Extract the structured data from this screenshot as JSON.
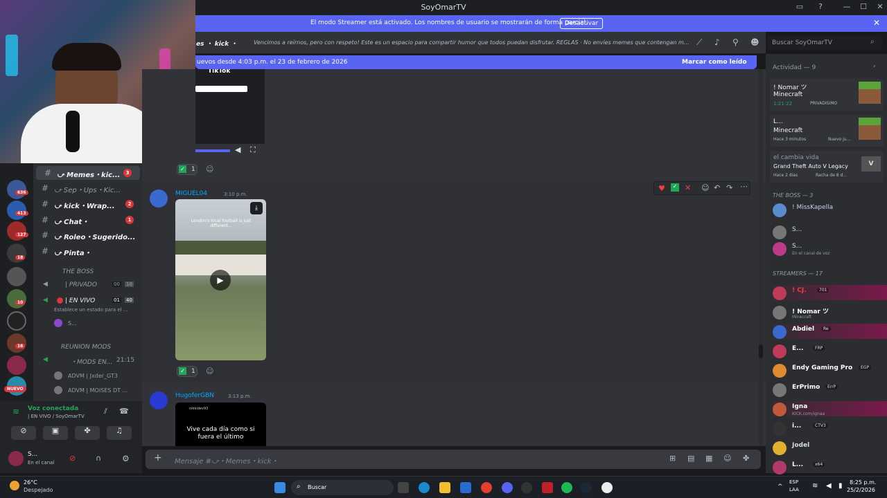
{
  "window": {
    "title": "SoyOmarTV"
  },
  "streamer_banner": {
    "message": "El modo Streamer está activado. Los nombres de usuario se mostrarán de forma parcial.",
    "button": "Desactivar"
  },
  "channel_header": {
    "name": "es ・ kick ・",
    "topic": "Vencimos a reírnos, pero con respeto! Este es un espacio para compartir humor que todos puedan disfrutar. REGLAS · No envíes memes que contengan m...",
    "search_placeholder": "Buscar SoyOmarTV"
  },
  "new_messages_bar": {
    "text": "uevos desde 4:03 p.m. el 23 de febrero de 2026",
    "action": "Marcar como leído"
  },
  "server_badges": [
    "636",
    "413",
    "127",
    "18",
    "10",
    "16"
  ],
  "channels": [
    {
      "name": "⤻ Memes・kic...",
      "badge": "3"
    },
    {
      "name": "⤻ Sep・Ups・Kic...",
      "badge": ""
    },
    {
      "name": "⤻ kick・Wrap...",
      "badge": "2"
    },
    {
      "name": "⤻ Chat・",
      "badge": "1"
    },
    {
      "name": "⤻ Roleo・Sugerido...",
      "badge": ""
    },
    {
      "name": "⤻ Pinta・",
      "badge": ""
    }
  ],
  "category_boss": "THE BOSS",
  "voice_channels": [
    {
      "name": "| PRIVADO",
      "count_a": "00",
      "count_b": "10"
    },
    {
      "name": "| EN VIVO",
      "count_a": "01",
      "count_b": "40"
    }
  ],
  "vc_status": "Establece un estado para el ...",
  "vc_user": "S...",
  "category_mods": "REUNION MODS",
  "mods_channel": {
    "name": "・MODS EN...",
    "time": "21:15"
  },
  "mods_users": [
    "ADVM | Jxder_GT3",
    "ADVM | MOISES DT ..."
  ],
  "new_label": "NUEVO",
  "voice_connected": {
    "title": "Voz conectada",
    "sub": "| EN VIVO / SoyOmarTV"
  },
  "user_panel": {
    "name": "S...",
    "status": "En el canal"
  },
  "messages": [
    {
      "author": "MIGUEL04",
      "time": "3:10 p.m.",
      "video_caption": "London's local football is just different...",
      "reaction_count": "1"
    },
    {
      "author": "HugoferGBN",
      "time": "3:13 p.m.",
      "video_caption": "Vive cada día como si fuera el último",
      "handle": "nikkidev93"
    }
  ],
  "prior_reaction_count": "1",
  "tiktok_label": "TikTok",
  "composer_placeholder": "Mensaje #⤻・Memes・kick・",
  "right_panel": {
    "activity_header": "Actividad — 9",
    "activities": [
      {
        "user": "! Nomar ツ",
        "game": "Minecraft",
        "meta": "1:21:22",
        "extra": "PRIVADISIMO"
      },
      {
        "user": "L...",
        "game": "Minecraft",
        "meta": "Hace 3 minutos",
        "extra": "Nuevo ju..."
      },
      {
        "user": "el cambia vida",
        "game": "Grand Theft Auto V Legacy",
        "meta": "Hace 2 días",
        "extra": "Racha de 8 d..."
      }
    ],
    "boss_header": "THE BOSS — 3",
    "boss_members": [
      {
        "name": "! MissKapella",
        "status": ""
      },
      {
        "name": "S...",
        "status": ""
      },
      {
        "name": "S...",
        "status": "En el canal de voz"
      }
    ],
    "streamers_header": "STREAMERS — 17",
    "streamers": [
      {
        "name": "! CJ.",
        "status": "",
        "tag": "701",
        "color": "#f23f43"
      },
      {
        "name": "! Nomar ツ",
        "status": "Minecraft",
        "tag": "",
        "color": "#ffffff"
      },
      {
        "name": "Abdiel",
        "status": "",
        "tag": "Re",
        "color": "#ffffff"
      },
      {
        "name": "E...",
        "status": "",
        "tag": "FRP",
        "color": "#ffffff"
      },
      {
        "name": "Endy Gaming Pro",
        "status": "",
        "tag": "EGP",
        "color": "#ffffff"
      },
      {
        "name": "ErPrimo",
        "status": "",
        "tag": "ErrP",
        "color": "#ffffff"
      },
      {
        "name": "Igna",
        "status": "KICK.com/ignaa",
        "tag": "",
        "color": "#ffffff"
      },
      {
        "name": "i...",
        "status": "",
        "tag": "CTV3",
        "color": "#ffffff"
      },
      {
        "name": "Jodel",
        "status": "",
        "tag": "",
        "color": "#dbdee1"
      },
      {
        "name": "L...",
        "status": "",
        "tag": "x64",
        "color": "#ffffff"
      }
    ]
  },
  "taskbar": {
    "weather_temp": "26°C",
    "weather_desc": "Despejado",
    "search": "Buscar",
    "lang_a": "ESP",
    "lang_b": "LAA",
    "time": "8:25 p.m.",
    "date": "25/2/2026"
  },
  "colors": {
    "blurple": "#5865f2",
    "bg": "#313338",
    "sidebar": "#2b2d31",
    "red": "#da373c",
    "green": "#23a55a"
  }
}
